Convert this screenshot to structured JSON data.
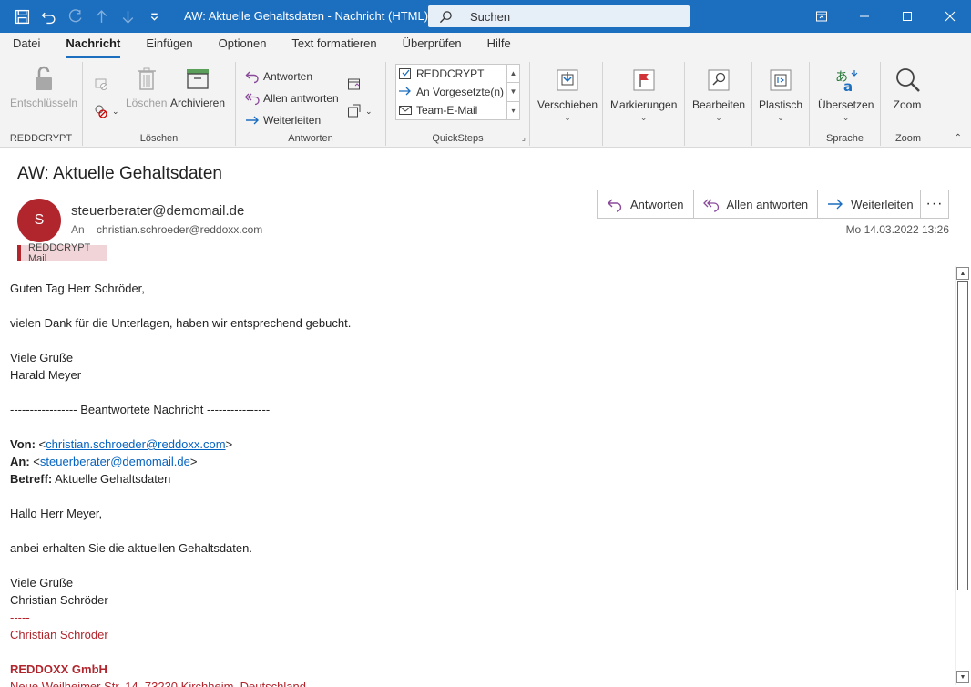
{
  "window": {
    "title": "AW: Aktuelle Gehaltsdaten  -  Nachricht (HTML)",
    "search_placeholder": "Suchen"
  },
  "ribbon_tabs": [
    "Datei",
    "Nachricht",
    "Einfügen",
    "Optionen",
    "Text formatieren",
    "Überprüfen",
    "Hilfe"
  ],
  "ribbon": {
    "reddcrypt": {
      "button": "Entschlüsseln",
      "label": "REDDCRYPT"
    },
    "loeschen": {
      "delete": "Löschen",
      "archive": "Archivieren",
      "label": "Löschen"
    },
    "antworten": {
      "reply": "Antworten",
      "reply_all": "Allen antworten",
      "forward": "Weiterleiten",
      "label": "Antworten"
    },
    "quicksteps": {
      "items": [
        "REDDCRYPT",
        "An Vorgesetzte(n)",
        "Team-E-Mail"
      ],
      "label": "QuickSteps"
    },
    "move": "Verschieben",
    "tags": "Markierungen",
    "edit": "Bearbeiten",
    "immersive": "Plastisch",
    "translate": "Übersetzen",
    "language_label": "Sprache",
    "zoom": "Zoom",
    "zoom_label": "Zoom"
  },
  "message": {
    "subject": "AW: Aktuelle Gehaltsdaten",
    "avatar_initial": "S",
    "sender": "steuerberater@demomail.de",
    "to_label": "An",
    "to": "christian.schroeder@reddoxx.com",
    "category": "REDDCRYPT Mail",
    "actions": {
      "reply": "Antworten",
      "reply_all": "Allen antworten",
      "forward": "Weiterleiten",
      "more": "···"
    },
    "datetime": "Mo 14.03.2022 13:26"
  },
  "body": {
    "greeting": "Guten Tag Herr Schröder,",
    "line1": "vielen Dank für die Unterlagen, haben wir entsprechend gebucht.",
    "closing1": "Viele Grüße",
    "name1": "Harald Meyer",
    "separator": "----------------- Beantwortete Nachricht ----------------",
    "from_label": "Von:",
    "from_email": "christian.schroeder@reddoxx.com",
    "to_label": "An:",
    "to_email": "steuerberater@demomail.de",
    "subject_label": "Betreff:",
    "subject_value": "Aktuelle Gehaltsdaten",
    "greeting2": "Hallo Herr Meyer,",
    "line2": "anbei erhalten Sie die aktuellen Gehaltsdaten.",
    "closing2": "Viele Grüße",
    "name2": "Christian Schröder",
    "sig_dashes": "-----",
    "sig_name": "Christian Schröder",
    "sig_company": "REDDOXX GmbH",
    "sig_address": "Neue Weilheimer Str. 14, 73230 Kirchheim, Deutschland"
  },
  "colors": {
    "titlebar": "#1c6ebf",
    "accent_red": "#b1252d",
    "link": "#0563c1"
  }
}
